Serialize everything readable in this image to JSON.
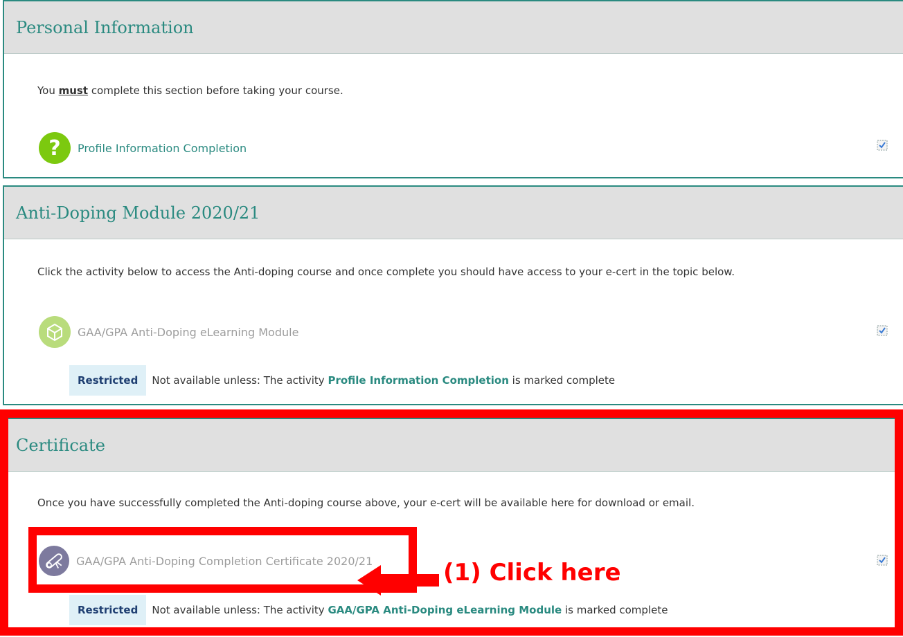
{
  "sections": [
    {
      "title": "Personal Information",
      "summary_pre": "You ",
      "summary_emph": "must",
      "summary_post": " complete this section before taking your course.",
      "activity": {
        "label": "Profile Information Completion",
        "icon": "question-icon"
      }
    },
    {
      "title": "Anti-Doping Module 2020/21",
      "summary": "Click the activity below to access the Anti-doping course and once complete you should have access to your e-cert in the topic below.",
      "activity": {
        "label": "GAA/GPA Anti-Doping eLearning Module",
        "icon": "scorm-package-icon"
      },
      "restriction": {
        "badge": "Restricted",
        "pre": "Not available unless: The activity ",
        "link": "Profile Information Completion",
        "post": " is marked complete"
      }
    },
    {
      "title": "Certificate",
      "summary": "Once you have successfully completed the Anti-doping course above, your e-cert will be available here for download or email.",
      "activity": {
        "label": "GAA/GPA Anti-Doping Completion Certificate 2020/21",
        "icon": "certificate-icon"
      },
      "restriction": {
        "badge": "Restricted",
        "pre": "Not available unless: The activity ",
        "link": "GAA/GPA Anti-Doping eLearning Module",
        "post": " is marked complete"
      }
    }
  ],
  "annotation": {
    "text": "(1) Click here"
  },
  "colors": {
    "accent": "#2a8a80",
    "header_bg": "#e0e0e0",
    "annotation_red": "#ff0000",
    "restricted_badge_bg": "#dff0f7",
    "question_icon": "#7cc90f",
    "scorm_icon": "#b9dc7c",
    "certificate_icon": "#7d7a9e"
  }
}
